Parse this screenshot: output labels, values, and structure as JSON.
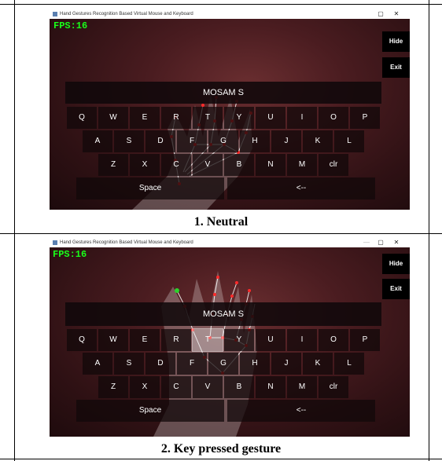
{
  "window": {
    "title": "Hand Gestures Recognition Based Virtual Mouse and Keyboard",
    "minimize": "—",
    "maximize": "▢",
    "close": "✕"
  },
  "overlay": {
    "fps": "FPS:16",
    "hide_label": "Hide",
    "exit_label": "Exit",
    "typed_text": "MOSAM S"
  },
  "keyboard": {
    "row1": [
      "Q",
      "W",
      "E",
      "R",
      "T",
      "Y",
      "U",
      "I",
      "O",
      "P"
    ],
    "row2": [
      "A",
      "S",
      "D",
      "F",
      "G",
      "H",
      "J",
      "K",
      "L"
    ],
    "row3": [
      "Z",
      "X",
      "C",
      "V",
      "B",
      "N",
      "M",
      "clr"
    ],
    "space_label": "Space",
    "backspace_label": "<--"
  },
  "panels": [
    {
      "caption": "1. Neutral",
      "pressed_key": ""
    },
    {
      "caption": "2. Key pressed gesture",
      "pressed_key": "T"
    }
  ],
  "colors": {
    "fps_text": "#19ff19",
    "background_dark_red": "#4a1c20",
    "landmark": "#ff2a2a"
  }
}
